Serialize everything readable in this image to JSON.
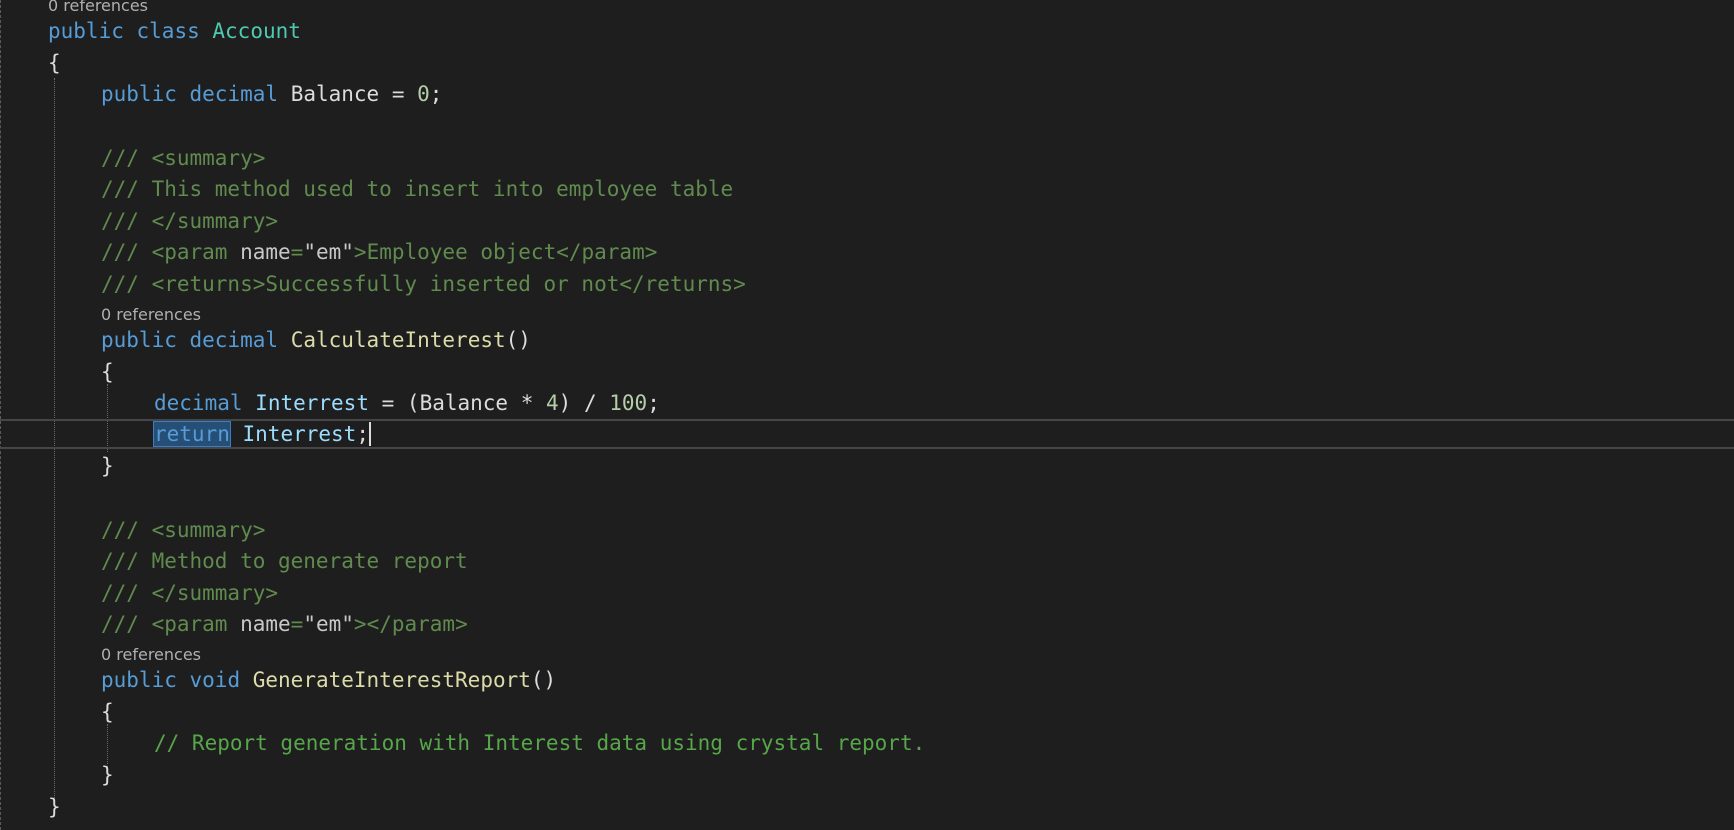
{
  "code": {
    "lens": {
      "class_refs": "0 references",
      "calc_refs": "0 references",
      "report_refs": "0 references"
    },
    "l1": {
      "kw1": "public",
      "kw2": "class",
      "name": "Account"
    },
    "l2": {
      "brace": "{"
    },
    "l3": {
      "kw1": "public",
      "kw2": "decimal",
      "name": "Balance",
      "op": " = ",
      "num": "0",
      "end": ";"
    },
    "l4": {
      "text": "/// <summary>"
    },
    "l5": {
      "text": "/// This method used to insert into employee table"
    },
    "l6": {
      "text": "/// </summary>"
    },
    "l7": {
      "pre": "/// <param ",
      "attr": "name",
      "eq": "=",
      "q1": "\"",
      "val": "em",
      "q2": "\"",
      "post": ">Employee object</param>"
    },
    "l8": {
      "text": "/// <returns>Successfully inserted or not</returns>"
    },
    "l9": {
      "kw1": "public",
      "kw2": "decimal",
      "name": "CalculateInterest",
      "paren": "()"
    },
    "l10": {
      "brace": "{"
    },
    "l11": {
      "kw": "decimal",
      "name": "Interrest",
      "op": " = ",
      "p1": "(",
      "ref": "Balance",
      "mul": " * ",
      "num1": "4",
      "p2": ")",
      "div": " / ",
      "num2": "100",
      "end": ";"
    },
    "l12": {
      "kw": "return",
      "name": "Interrest",
      "end": ";"
    },
    "l13": {
      "brace": "}"
    },
    "l14": {
      "text": "/// <summary>"
    },
    "l15": {
      "text": "/// Method to generate report"
    },
    "l16": {
      "text": "/// </summary>"
    },
    "l17": {
      "pre": "/// <param ",
      "attr": "name",
      "eq": "=",
      "q1": "\"",
      "val": "em",
      "q2": "\"",
      "post": "></param>"
    },
    "l18": {
      "kw1": "public",
      "kw2": "void",
      "name": "GenerateInterestReport",
      "paren": "()"
    },
    "l19": {
      "brace": "{"
    },
    "l20": {
      "text": "// Report generation with Interest data using crystal report."
    },
    "l21": {
      "brace": "}"
    },
    "l22": {
      "brace": "}"
    }
  }
}
